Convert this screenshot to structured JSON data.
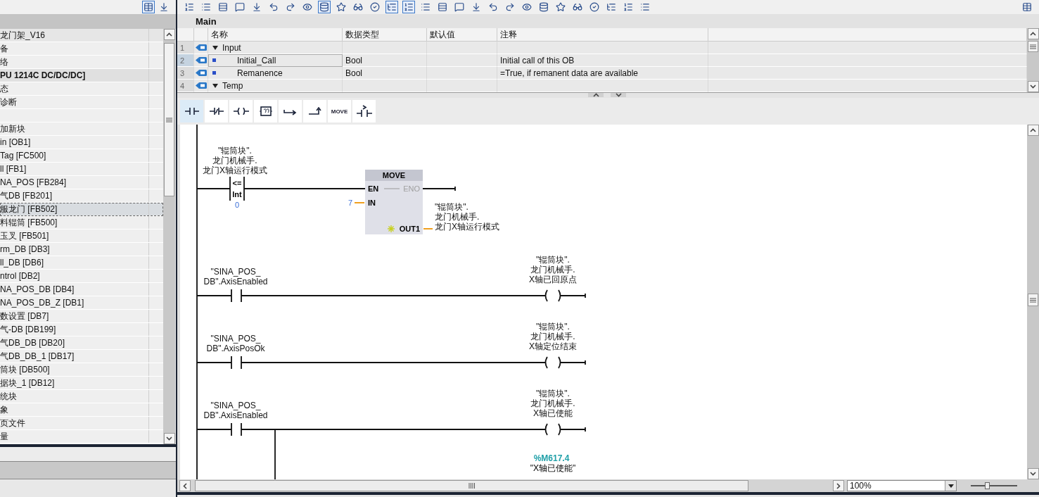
{
  "left_panel": {
    "toolbar_buttons": [
      {
        "pressed": true
      },
      {
        "pressed": false
      }
    ],
    "tree_items": [
      {
        "label": "龙门架_V16",
        "kind": "project",
        "selected": false
      },
      {
        "label": "备",
        "kind": "item",
        "selected": false
      },
      {
        "label": "络",
        "kind": "item",
        "selected": false
      },
      {
        "label": "PU 1214C DC/DC/DC]",
        "kind": "device",
        "selected": false
      },
      {
        "label": "态",
        "kind": "item",
        "selected": false
      },
      {
        "label": "诊断",
        "kind": "item",
        "selected": false
      },
      {
        "kind": "item",
        "selected": false
      },
      {
        "label": "加新块",
        "kind": "item",
        "selected": false
      },
      {
        "label": "in [OB1]",
        "kind": "item",
        "selected": false
      },
      {
        "label": "Tag [FC500]",
        "kind": "item",
        "selected": false
      },
      {
        "label": "ll [FB1]",
        "kind": "item",
        "selected": false
      },
      {
        "label": "NA_POS [FB284]",
        "kind": "item",
        "selected": false
      },
      {
        "label": "气DB [FB201]",
        "kind": "item",
        "selected": false
      },
      {
        "label": "服龙门 [FB502]",
        "kind": "item",
        "selected": true
      },
      {
        "label": "料辊筒 [FB500]",
        "kind": "item",
        "selected": false
      },
      {
        "label": "玉叉 [FB501]",
        "kind": "item",
        "selected": false
      },
      {
        "label": "rm_DB [DB3]",
        "kind": "item",
        "selected": false
      },
      {
        "label": "ll_DB [DB6]",
        "kind": "item",
        "selected": false
      },
      {
        "label": "ntrol [DB2]",
        "kind": "item",
        "selected": false
      },
      {
        "label": "NA_POS_DB [DB4]",
        "kind": "item",
        "selected": false
      },
      {
        "label": "NA_POS_DB_Z [DB1]",
        "kind": "item",
        "selected": false
      },
      {
        "label": "数设置 [DB7]",
        "kind": "item",
        "selected": false
      },
      {
        "label": "气-DB [DB199]",
        "kind": "item",
        "selected": false
      },
      {
        "label": "气DB_DB [DB20]",
        "kind": "item",
        "selected": false
      },
      {
        "label": "气DB_DB_1 [DB17]",
        "kind": "item",
        "selected": false
      },
      {
        "label": "筒块 [DB500]",
        "kind": "item",
        "selected": false
      },
      {
        "label": "据块_1 [DB12]",
        "kind": "item",
        "selected": false
      },
      {
        "label": "统块",
        "kind": "item",
        "selected": false
      },
      {
        "label": "象",
        "kind": "item",
        "selected": false
      },
      {
        "label": "页文件",
        "kind": "item",
        "selected": false
      },
      {
        "label": "量",
        "kind": "item",
        "selected": false
      }
    ]
  },
  "toolbar_buttons": [
    {
      "pressed": false
    },
    {
      "pressed": false
    },
    {
      "pressed": false
    },
    {
      "pressed": false
    },
    {
      "pressed": false
    },
    {
      "pressed": false
    },
    {
      "pressed": false
    },
    {
      "pressed": false
    },
    {
      "pressed": true
    },
    {
      "pressed": false
    },
    {
      "pressed": false
    },
    {
      "pressed": false
    },
    {
      "pressed": true
    },
    {
      "pressed": true
    },
    {
      "pressed": false
    },
    {
      "pressed": false
    },
    {
      "pressed": false
    },
    {
      "pressed": false
    },
    {
      "pressed": false
    },
    {
      "pressed": false
    },
    {
      "pressed": false
    },
    {
      "pressed": false
    },
    {
      "pressed": false
    },
    {
      "pressed": false
    },
    {
      "pressed": false
    },
    {
      "pressed": false
    },
    {
      "pressed": false
    },
    {
      "pressed": false
    }
  ],
  "toolbar_end_buttons": [
    {
      "pressed": false
    }
  ],
  "block": {
    "title": "Main",
    "interface": {
      "columns": [
        "名称",
        "数据类型",
        "默认值",
        "注释"
      ],
      "rows": [
        {
          "number": "1",
          "kind": "section",
          "expanded": true,
          "name": "Input",
          "selected": false
        },
        {
          "number": "2",
          "kind": "param",
          "name": "Initial_Call",
          "data_type": "Bool",
          "comment": "Initial call of this OB",
          "selected": true
        },
        {
          "number": "3",
          "kind": "param",
          "name": "Remanence",
          "data_type": "Bool",
          "comment": "=True, if remanent data are available",
          "selected": false
        },
        {
          "number": "4",
          "kind": "section",
          "expanded": true,
          "name": "Temp",
          "selected": false
        }
      ]
    }
  },
  "instructions": [
    {
      "kind": "contact_no",
      "selected": true
    },
    {
      "kind": "contact_nc",
      "selected": false
    },
    {
      "kind": "coil",
      "selected": false
    },
    {
      "kind": "empty_box",
      "selected": false
    },
    {
      "kind": "branch_open",
      "selected": false
    },
    {
      "kind": "branch_close",
      "selected": false
    },
    {
      "kind": "text",
      "label": "MOVE",
      "selected": false
    },
    {
      "kind": "compare",
      "selected": false
    }
  ],
  "networks": [
    {
      "kind": "compare_move",
      "contact": {
        "operand": [
          "\"辊筒块\".",
          "龙门机械手.",
          "龙门X轴运行模式"
        ],
        "operator": "<=",
        "type": "Int",
        "value": "0"
      },
      "box": {
        "title": "MOVE",
        "en": "EN",
        "eno": "ENO",
        "in_pin": "IN",
        "in_value": "7",
        "out_pin": "OUT1",
        "out_operand": [
          "\"辊筒块\".",
          "龙门机械手.",
          "龙门X轴运行模式"
        ]
      }
    },
    {
      "kind": "contact_coil",
      "contact": {
        "operand": [
          "\"SINA_POS_",
          "DB\".AxisEnabled"
        ]
      },
      "coil": {
        "operand": [
          "\"辊筒块\".",
          "龙门机械手.",
          "X轴已回原点"
        ]
      }
    },
    {
      "kind": "contact_coil",
      "contact": {
        "operand": [
          "\"SINA_POS_",
          "DB\".AxisPosOk"
        ]
      },
      "coil": {
        "operand": [
          "\"辊筒块\".",
          "龙门机械手.",
          "X轴定位结束"
        ]
      }
    },
    {
      "kind": "contact_coil",
      "contact": {
        "operand": [
          "\"SINA_POS_",
          "DB\".AxisEnabled"
        ]
      },
      "coil": {
        "operand": [
          "\"辊筒块\".",
          "龙门机械手.",
          "X轴已使能"
        ]
      },
      "branch": {
        "address": "%M617.4",
        "operand": "\"X轴已使能\""
      }
    }
  ],
  "zoom": {
    "value": "100%",
    "level": 0.35
  }
}
